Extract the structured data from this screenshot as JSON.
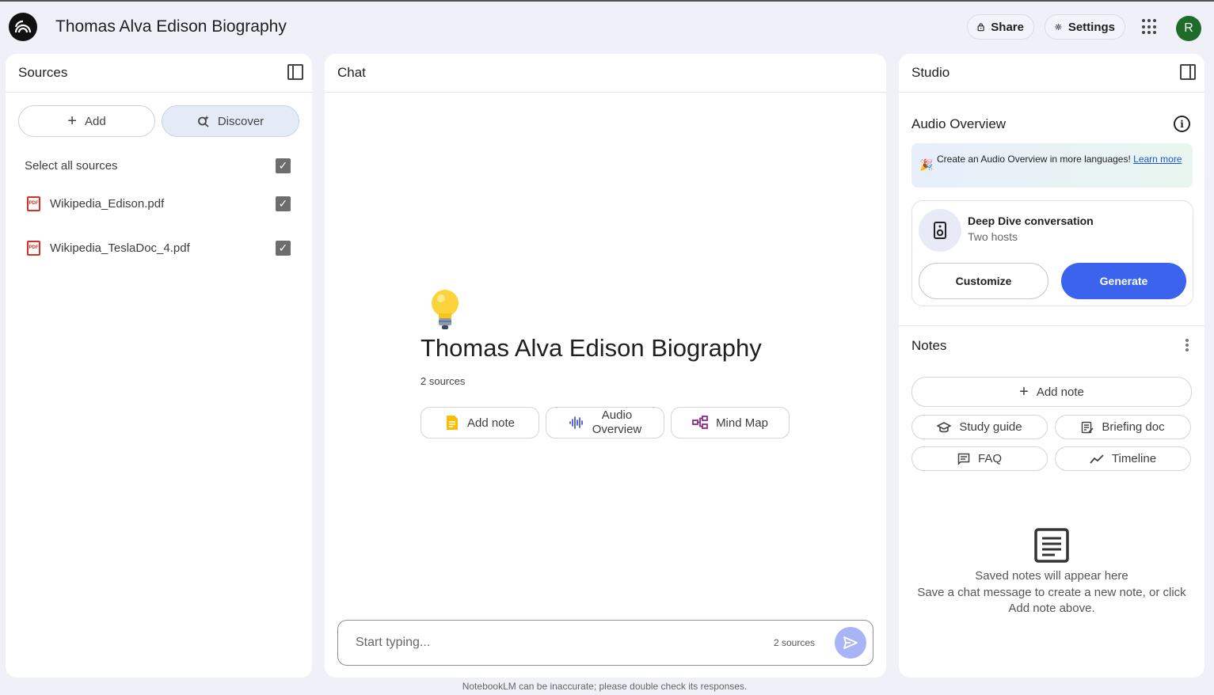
{
  "app": {
    "title": "Thomas Alva Edison Biography",
    "avatar_initial": "R"
  },
  "topbar": {
    "share_label": "Share",
    "settings_label": "Settings"
  },
  "sources": {
    "header": "Sources",
    "add_label": "Add",
    "discover_label": "Discover",
    "select_all_label": "Select all sources",
    "items": [
      {
        "name": "Wikipedia_Edison.pdf",
        "checked": true
      },
      {
        "name": "Wikipedia_TeslaDoc_4.pdf",
        "checked": true
      }
    ]
  },
  "chat": {
    "header": "Chat",
    "notebook_title": "Thomas Alva Edison Biography",
    "sources_count": "2 sources",
    "actions": {
      "add_note": "Add note",
      "audio_line1": "Audio",
      "audio_line2": "Overview",
      "mind_map": "Mind Map"
    },
    "input_placeholder": "Start typing...",
    "input_sources_count": "2 sources"
  },
  "studio": {
    "header": "Studio",
    "audio_overview_title": "Audio Overview",
    "banner_text": "Create an Audio Overview in more languages!",
    "banner_link": "Learn more",
    "deep_dive_title": "Deep Dive conversation",
    "deep_dive_sub": "Two hosts",
    "customize_label": "Customize",
    "generate_label": "Generate",
    "notes_title": "Notes",
    "add_note_label": "Add note",
    "study_guide_label": "Study guide",
    "briefing_doc_label": "Briefing doc",
    "faq_label": "FAQ",
    "timeline_label": "Timeline",
    "empty_title": "Saved notes will appear here",
    "empty_sub": "Save a chat message to create a new note, or click Add note above."
  },
  "footer": {
    "disclaimer": "NotebookLM can be inaccurate; please double check its responses."
  },
  "colors": {
    "accent": "#3b63ed",
    "background": "#eff0f8",
    "send": "#a9b4f6"
  }
}
